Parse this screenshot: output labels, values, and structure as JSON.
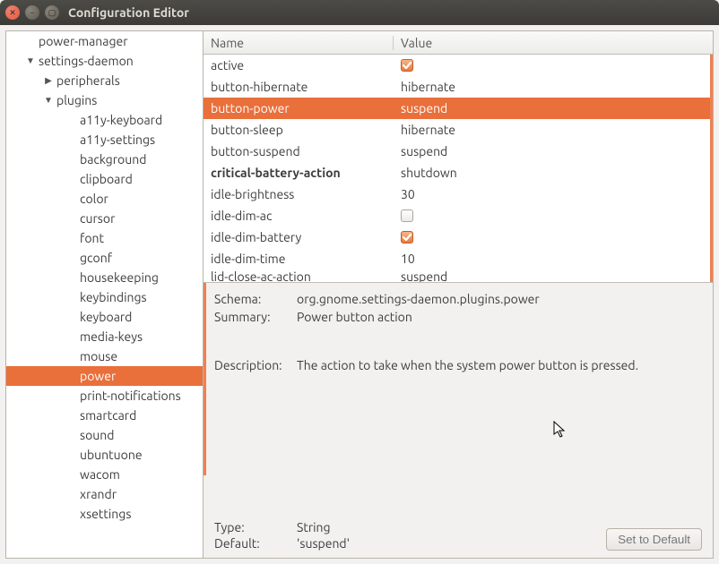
{
  "window": {
    "title": "Configuration Editor"
  },
  "tree": {
    "items": [
      {
        "label": "power-manager",
        "depth": 0,
        "selected": false
      },
      {
        "label": "settings-daemon",
        "depth": 0,
        "selected": false,
        "expander": "▼"
      },
      {
        "label": "peripherals",
        "depth": 1,
        "selected": false,
        "expander": "▶"
      },
      {
        "label": "plugins",
        "depth": 1,
        "selected": false,
        "expander": "▼"
      },
      {
        "label": "a11y-keyboard",
        "depth": 2,
        "selected": false
      },
      {
        "label": "a11y-settings",
        "depth": 2,
        "selected": false
      },
      {
        "label": "background",
        "depth": 2,
        "selected": false
      },
      {
        "label": "clipboard",
        "depth": 2,
        "selected": false
      },
      {
        "label": "color",
        "depth": 2,
        "selected": false
      },
      {
        "label": "cursor",
        "depth": 2,
        "selected": false
      },
      {
        "label": "font",
        "depth": 2,
        "selected": false
      },
      {
        "label": "gconf",
        "depth": 2,
        "selected": false
      },
      {
        "label": "housekeeping",
        "depth": 2,
        "selected": false
      },
      {
        "label": "keybindings",
        "depth": 2,
        "selected": false
      },
      {
        "label": "keyboard",
        "depth": 2,
        "selected": false
      },
      {
        "label": "media-keys",
        "depth": 2,
        "selected": false
      },
      {
        "label": "mouse",
        "depth": 2,
        "selected": false
      },
      {
        "label": "power",
        "depth": 2,
        "selected": true
      },
      {
        "label": "print-notifications",
        "depth": 2,
        "selected": false
      },
      {
        "label": "smartcard",
        "depth": 2,
        "selected": false
      },
      {
        "label": "sound",
        "depth": 2,
        "selected": false
      },
      {
        "label": "ubuntuone",
        "depth": 2,
        "selected": false
      },
      {
        "label": "wacom",
        "depth": 2,
        "selected": false
      },
      {
        "label": "xrandr",
        "depth": 2,
        "selected": false
      },
      {
        "label": "xsettings",
        "depth": 2,
        "selected": false
      }
    ]
  },
  "columns": {
    "name": "Name",
    "value": "Value"
  },
  "rows": [
    {
      "name": "active",
      "type": "bool",
      "checked": true,
      "selected": false
    },
    {
      "name": "button-hibernate",
      "type": "text",
      "value": "hibernate",
      "selected": false
    },
    {
      "name": "button-power",
      "type": "text",
      "value": "suspend",
      "selected": true
    },
    {
      "name": "button-sleep",
      "type": "text",
      "value": "hibernate",
      "selected": false
    },
    {
      "name": "button-suspend",
      "type": "text",
      "value": "suspend",
      "selected": false
    },
    {
      "name": "critical-battery-action",
      "type": "text",
      "value": "shutdown",
      "bold": true,
      "selected": false
    },
    {
      "name": "idle-brightness",
      "type": "text",
      "value": "30",
      "selected": false
    },
    {
      "name": "idle-dim-ac",
      "type": "bool",
      "checked": false,
      "selected": false
    },
    {
      "name": "idle-dim-battery",
      "type": "bool",
      "checked": true,
      "selected": false
    },
    {
      "name": "idle-dim-time",
      "type": "text",
      "value": "10",
      "selected": false
    },
    {
      "name": "lid-close-ac-action",
      "type": "text",
      "value": "suspend",
      "selected": false,
      "cut": true
    }
  ],
  "info": {
    "labels": {
      "schema": "Schema:",
      "summary": "Summary:",
      "description": "Description:",
      "type": "Type:",
      "default": "Default:"
    },
    "schema": "org.gnome.settings-daemon.plugins.power",
    "summary": "Power button action",
    "description": "The action to take when the system power button is pressed.",
    "type": "String",
    "default": "'suspend'",
    "set_default_label": "Set to Default"
  }
}
